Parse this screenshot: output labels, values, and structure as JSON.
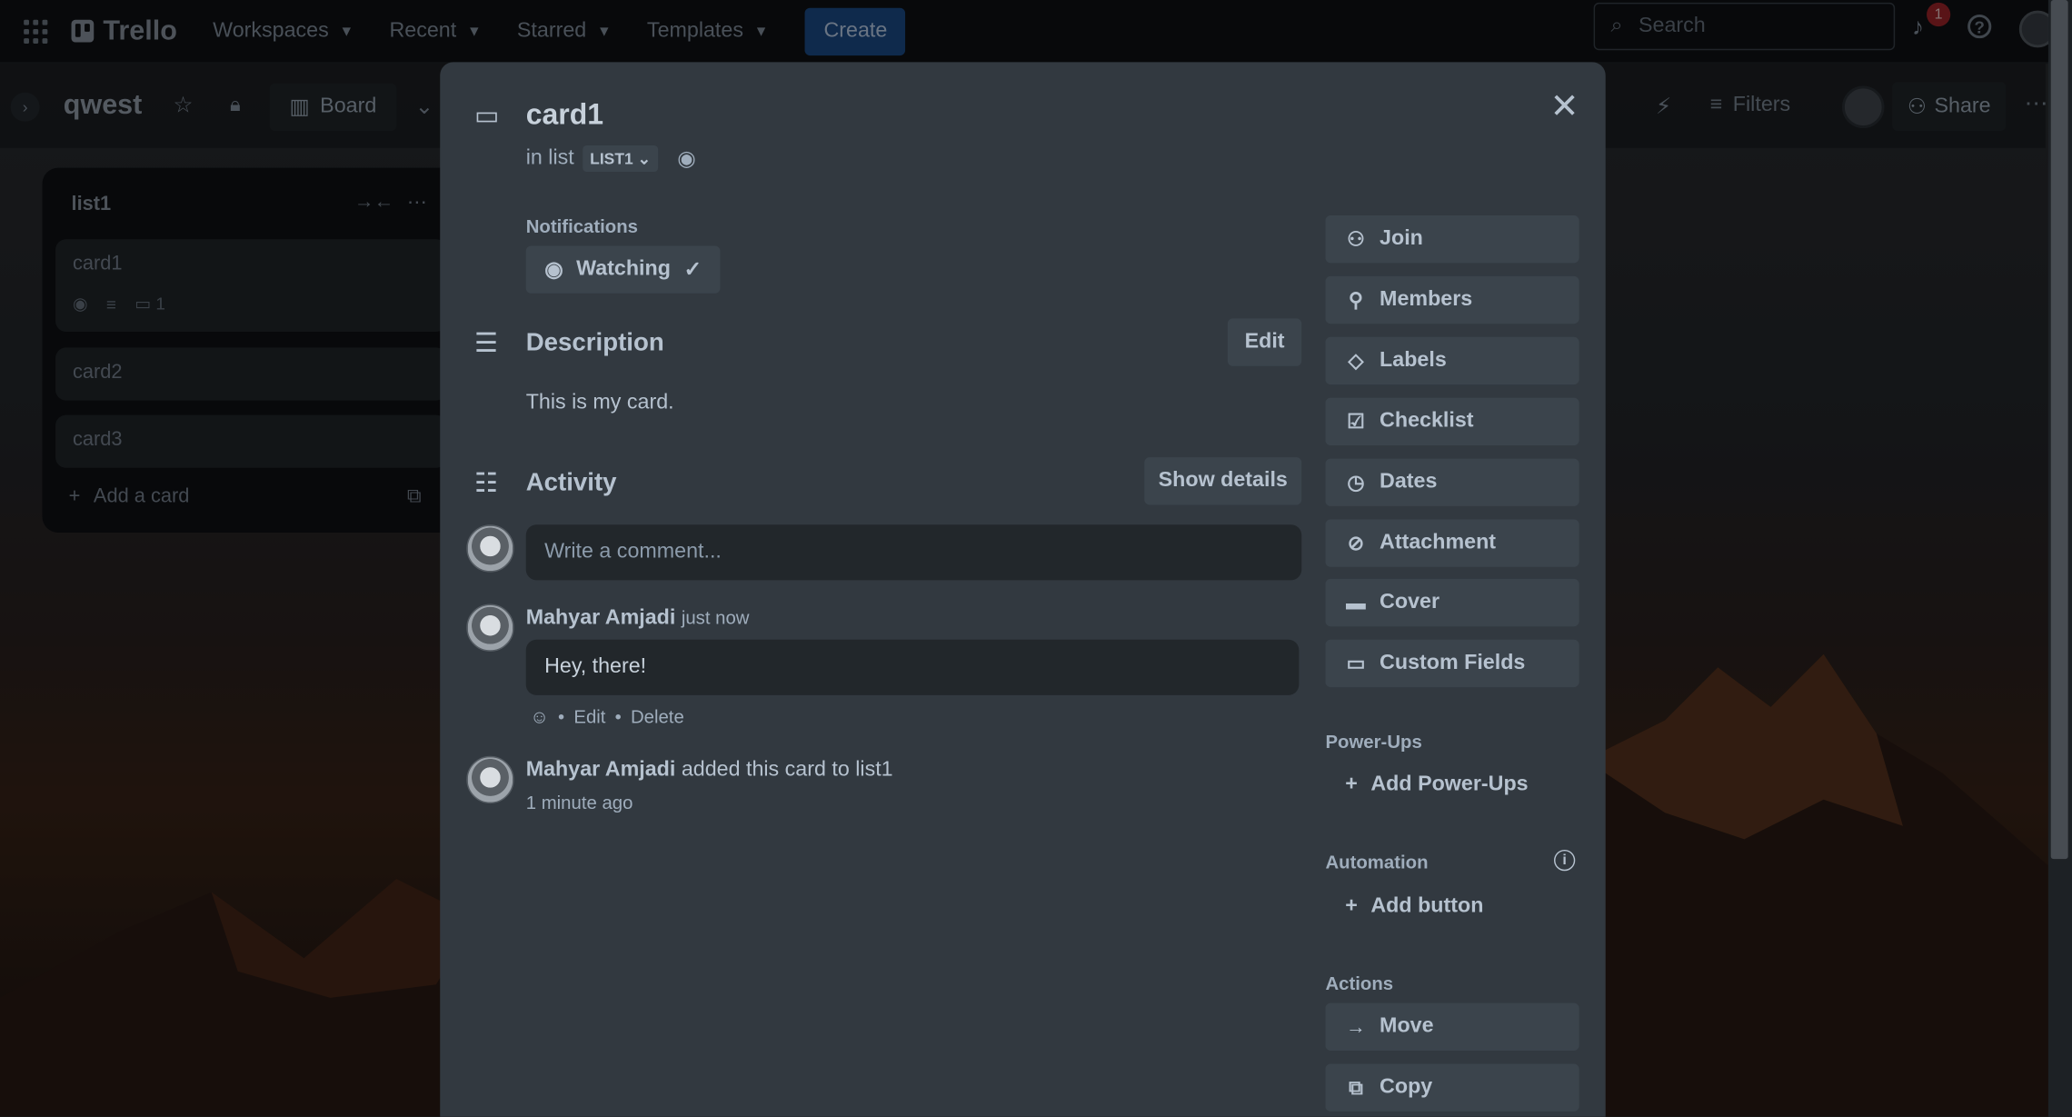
{
  "topnav": {
    "logo": "Trello",
    "items": [
      "Workspaces",
      "Recent",
      "Starred",
      "Templates"
    ],
    "create_label": "Create",
    "search_placeholder": "Search",
    "notification_count": "1"
  },
  "board": {
    "name": "qwest",
    "view_label": "Board",
    "filters_label": "Filters",
    "share_label": "Share"
  },
  "list": {
    "title": "list1",
    "cards": [
      {
        "title": "card1",
        "comment_count": "1"
      },
      {
        "title": "card2"
      },
      {
        "title": "card3"
      }
    ],
    "add_card_label": "Add a card"
  },
  "modal": {
    "title": "card1",
    "in_list_prefix": "in list",
    "list_name": "LIST1",
    "notifications_label": "Notifications",
    "watching_label": "Watching",
    "description_title": "Description",
    "edit_label": "Edit",
    "description_text": "This is my card.",
    "activity_title": "Activity",
    "show_details_label": "Show details",
    "comment_placeholder": "Write a comment...",
    "comment": {
      "author": "Mahyar Amjadi",
      "time": "just now",
      "text": "Hey, there!",
      "actions": [
        "Edit",
        "Delete"
      ]
    },
    "activity_entry": {
      "author": "Mahyar Amjadi",
      "text": "added this card to list1",
      "time": "1 minute ago"
    },
    "side_buttons": [
      {
        "label": "Join",
        "icon": "add-person-icon"
      },
      {
        "label": "Members",
        "icon": "person-icon"
      },
      {
        "label": "Labels",
        "icon": "tag-icon"
      },
      {
        "label": "Checklist",
        "icon": "checkbox-icon"
      },
      {
        "label": "Dates",
        "icon": "clock-icon"
      },
      {
        "label": "Attachment",
        "icon": "paperclip-icon"
      },
      {
        "label": "Cover",
        "icon": "cover-icon"
      },
      {
        "label": "Custom Fields",
        "icon": "fields-icon"
      }
    ],
    "powerups_label": "Power-Ups",
    "add_powerups_label": "Add Power-Ups",
    "automation_label": "Automation",
    "add_button_label": "Add button",
    "actions_label": "Actions",
    "move_label": "Move",
    "copy_label": "Copy"
  }
}
